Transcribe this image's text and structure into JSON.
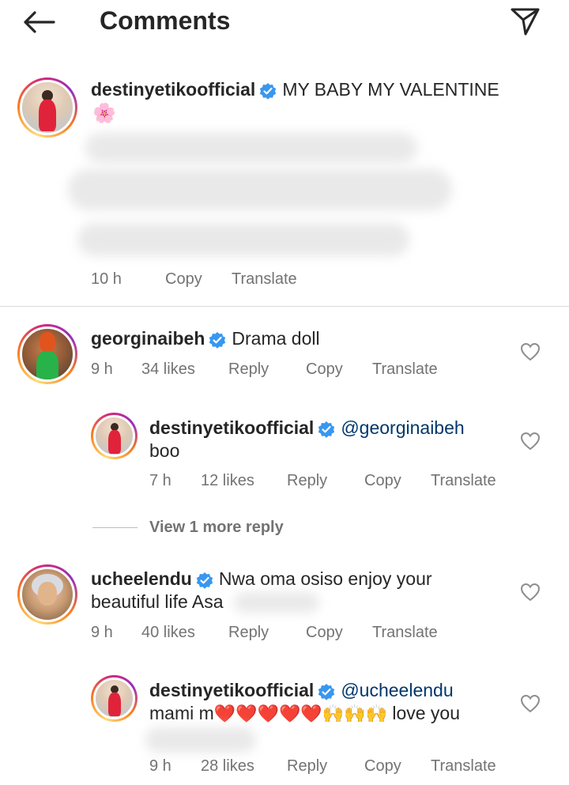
{
  "header": {
    "title": "Comments",
    "back_icon": "arrow-left-icon",
    "share_icon": "paper-plane-icon"
  },
  "caption": {
    "username": "destinyetikoofficial",
    "text": "MY BABY MY VALENTINE",
    "emoji": "🌸",
    "time": "10 h",
    "copy": "Copy",
    "translate": "Translate"
  },
  "comments": [
    {
      "username": "georginaibeh",
      "text": "Drama doll",
      "time": "9 h",
      "likes": "34 likes",
      "reply": "Reply",
      "copy": "Copy",
      "translate": "Translate",
      "replies": [
        {
          "username": "destinyetikoofficial",
          "mention": "@georginaibeh",
          "text": "boo",
          "time": "7 h",
          "likes": "12 likes",
          "reply": "Reply",
          "copy": "Copy",
          "translate": "Translate"
        }
      ],
      "view_more": "View 1 more reply"
    },
    {
      "username": "ucheelendu",
      "text_line1": "Nwa oma osiso enjoy your",
      "text_line2": "beautiful life Asa",
      "time": "9 h",
      "likes": "40 likes",
      "reply": "Reply",
      "copy": "Copy",
      "translate": "Translate",
      "replies": [
        {
          "username": "destinyetikoofficial",
          "mention": "@ucheelendu",
          "text_prefix": "mami m",
          "hearts": "❤️❤️❤️❤️❤️",
          "hands": "🙌🙌🙌",
          "text_suffix": "love you",
          "time": "9 h",
          "likes": "28 likes",
          "reply": "Reply",
          "copy": "Copy",
          "translate": "Translate"
        }
      ]
    }
  ],
  "colors": {
    "verified": "#3897f0",
    "mention": "#00376b",
    "meta": "#737373",
    "divider": "#dbdbdb"
  }
}
